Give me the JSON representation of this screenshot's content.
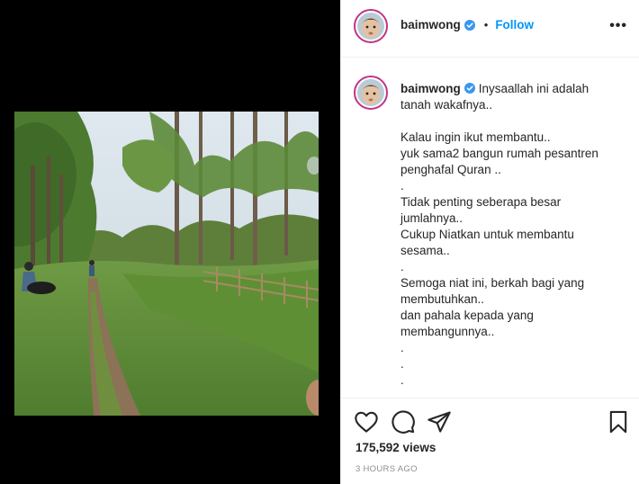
{
  "post": {
    "username": "baimwong",
    "follow_label": "Follow",
    "separator": "•",
    "more_label": "•••",
    "caption_lines": [
      "Inysaallah ini adalah",
      "tanah wakafnya..",
      "",
      "Kalau ingin ikut membantu..",
      "yuk sama2 bangun rumah pesantren",
      "penghafal Quran ..",
      ".",
      "Tidak penting seberapa besar",
      "jumlahnya..",
      "Cukup Niatkan untuk membantu",
      "sesama..",
      ".",
      "Semoga niat ini, berkah bagi yang",
      "membutuhkan..",
      "dan pahala kepada yang",
      "membangunnya..",
      ".",
      ".",
      "."
    ],
    "views": "175,592 views",
    "timestamp": "3 HOURS AGO"
  },
  "icons": {
    "like": "heart-icon",
    "comment": "comment-icon",
    "share": "paper-plane-icon",
    "save": "bookmark-icon",
    "verified": "verified-badge-icon"
  },
  "colors": {
    "accent": "#0095f6",
    "text": "#262626",
    "muted": "#8e8e8e",
    "media_background": "#000000"
  }
}
